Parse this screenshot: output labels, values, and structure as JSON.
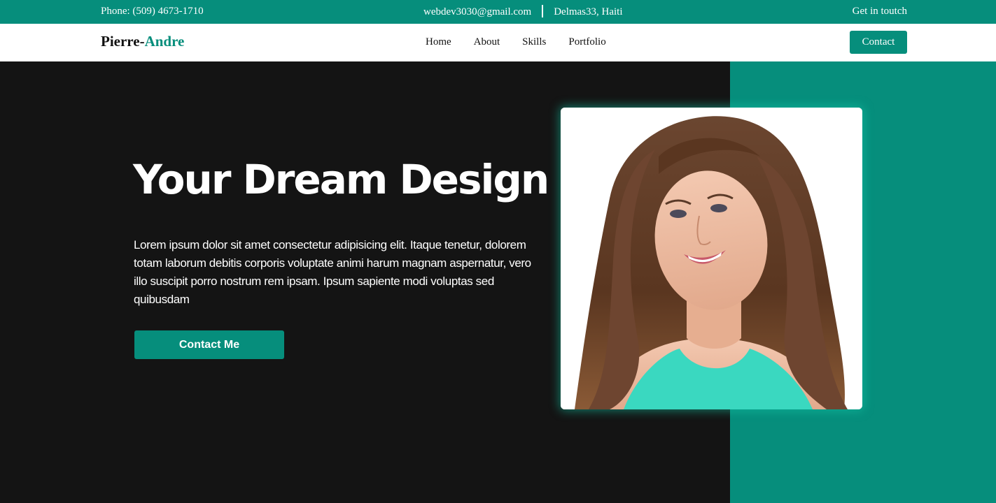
{
  "topbar": {
    "phone": "Phone: (509) 4673-1710",
    "email": "webdev3030@gmail.com",
    "location": "Delmas33, Haiti",
    "get_in_touch": "Get in toutch"
  },
  "navbar": {
    "brand_first": "Pierre-",
    "brand_second": "Andre",
    "links": [
      "Home",
      "About",
      "Skills",
      "Portfolio"
    ],
    "contact_label": "Contact"
  },
  "hero": {
    "heading": "Your Dream Design",
    "paragraph": "Lorem ipsum dolor sit amet consectetur adipisicing elit. Itaque tenetur, dolorem totam laborum debitis corporis voluptate animi harum magnam aspernatur, vero illo suscipit porro nostrum rem ipsam. Ipsum sapiente modi voluptas sed quibusdam",
    "cta_label": "Contact Me"
  },
  "colors": {
    "accent": "#068e7c",
    "dark_background": "#141414",
    "white": "#ffffff"
  }
}
